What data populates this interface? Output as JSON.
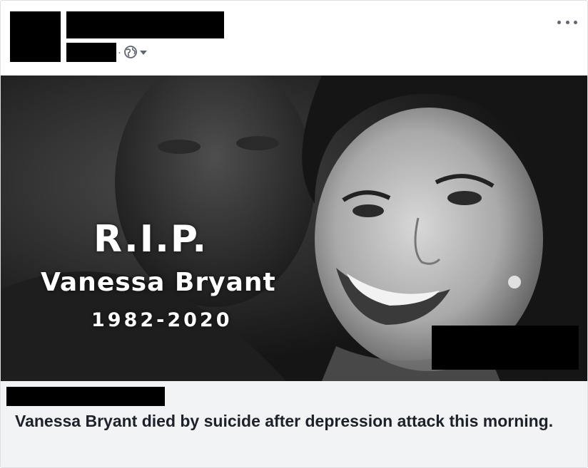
{
  "post": {
    "privacy_icon": "globe-icon",
    "audience_caret_icon": "caret-down-icon",
    "more_icon": "more-options-icon",
    "meta_separator": "·"
  },
  "image": {
    "title": "R.I.P.",
    "name": "Vanessa Bryant",
    "years": "1982-2020"
  },
  "link_preview": {
    "headline": "Vanessa Bryant died by suicide after depression attack this morning."
  },
  "colors": {
    "meta_gray": "#606770",
    "footer_bg": "#f2f3f5",
    "headline_text": "#1d2129"
  }
}
